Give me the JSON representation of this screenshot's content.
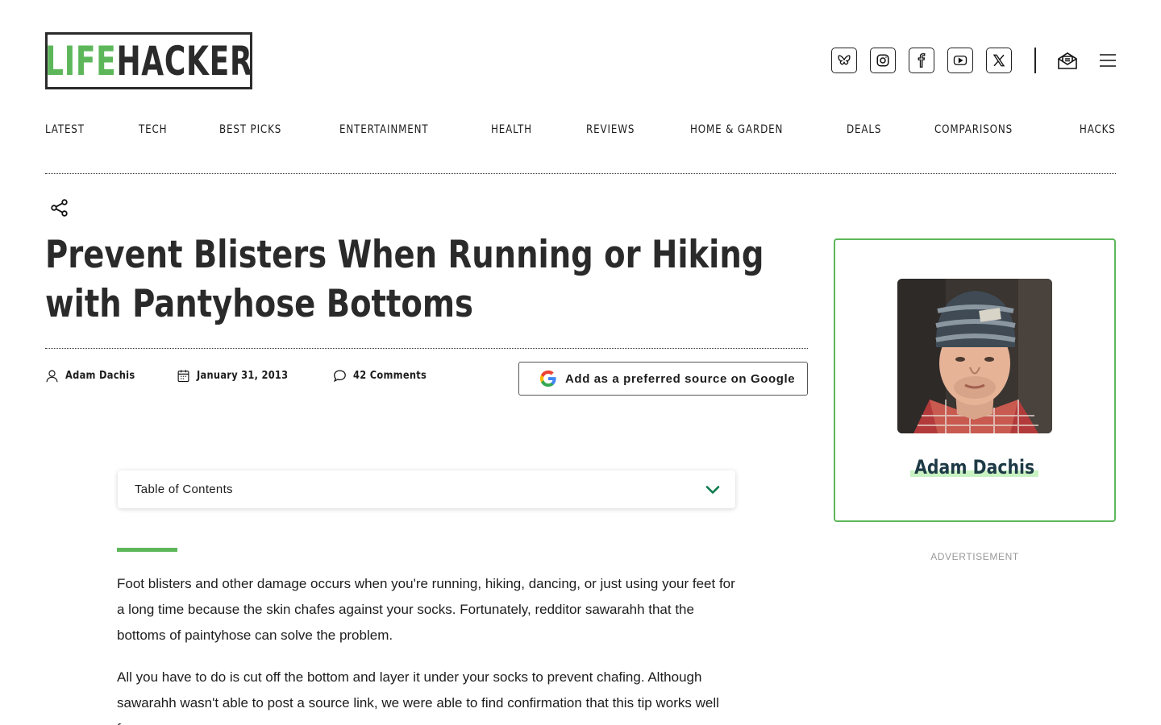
{
  "brand": {
    "logo_part1": "LIFE",
    "logo_part2": "HACKER",
    "accent_color": "#5db75a"
  },
  "header": {
    "social": [
      {
        "icon": "bluesky-icon"
      },
      {
        "icon": "instagram-icon"
      },
      {
        "icon": "facebook-icon"
      },
      {
        "icon": "youtube-icon"
      },
      {
        "icon": "x-icon"
      }
    ]
  },
  "nav": {
    "items": [
      "LATEST",
      "TECH",
      "BEST PICKS",
      "ENTERTAINMENT",
      "HEALTH",
      "REVIEWS",
      "HOME & GARDEN",
      "DEALS",
      "COMPARISONS",
      "HACKS"
    ]
  },
  "article": {
    "title": "Prevent Blisters When Running or Hiking with Pantyhose Bottoms",
    "author": "Adam Dachis",
    "date": "January 31, 2013",
    "comments": "42 Comments",
    "google_button": "Add as a preferred source on Google",
    "toc_label": "Table of Contents",
    "p1": "Foot blisters and other damage occurs when you're running, hiking, dancing, or just using your feet for a long time because the skin chafes against your socks. Fortunately, redditor sawarahh that the bottoms of paintyhose can solve the problem.",
    "p2": "All you have to do is cut off the bottom and layer it under your socks to prevent chafing. Although sawarahh wasn't able to post a source link, we were able to find confirmation that this tip works well from"
  },
  "sidebar": {
    "author_name": "Adam Dachis",
    "ad_label": "ADVERTISEMENT"
  }
}
